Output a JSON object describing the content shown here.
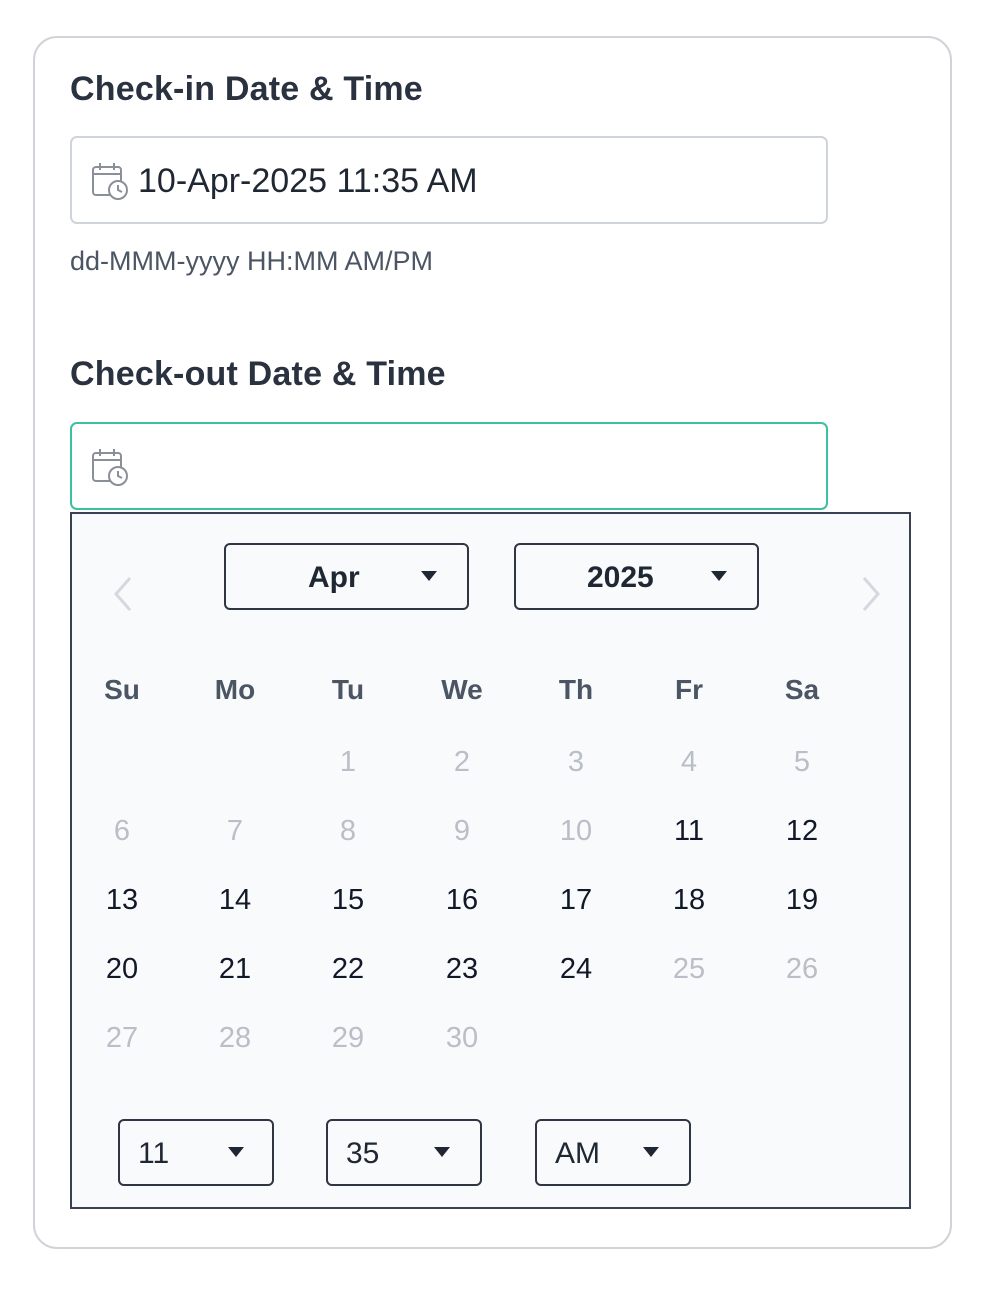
{
  "checkin": {
    "label": "Check-in Date & Time",
    "value": "10-Apr-2025 11:35 AM",
    "helper": "dd-MMM-yyyy HH:MM AM/PM",
    "icon": "calendar-clock-icon"
  },
  "checkout": {
    "label": "Check-out Date & Time",
    "value": "",
    "icon": "calendar-clock-icon"
  },
  "picker": {
    "month": "Apr",
    "year": "2025",
    "weekdays": [
      "Su",
      "Mo",
      "Tu",
      "We",
      "Th",
      "Fr",
      "Sa"
    ],
    "weeks": [
      [
        null,
        null,
        {
          "d": "1",
          "enabled": false
        },
        {
          "d": "2",
          "enabled": false
        },
        {
          "d": "3",
          "enabled": false
        },
        {
          "d": "4",
          "enabled": false
        },
        {
          "d": "5",
          "enabled": false
        }
      ],
      [
        {
          "d": "6",
          "enabled": false
        },
        {
          "d": "7",
          "enabled": false
        },
        {
          "d": "8",
          "enabled": false
        },
        {
          "d": "9",
          "enabled": false
        },
        {
          "d": "10",
          "enabled": false
        },
        {
          "d": "11",
          "enabled": true
        },
        {
          "d": "12",
          "enabled": true
        }
      ],
      [
        {
          "d": "13",
          "enabled": true
        },
        {
          "d": "14",
          "enabled": true
        },
        {
          "d": "15",
          "enabled": true
        },
        {
          "d": "16",
          "enabled": true
        },
        {
          "d": "17",
          "enabled": true
        },
        {
          "d": "18",
          "enabled": true
        },
        {
          "d": "19",
          "enabled": true
        }
      ],
      [
        {
          "d": "20",
          "enabled": true
        },
        {
          "d": "21",
          "enabled": true
        },
        {
          "d": "22",
          "enabled": true
        },
        {
          "d": "23",
          "enabled": true
        },
        {
          "d": "24",
          "enabled": true
        },
        {
          "d": "25",
          "enabled": false
        },
        {
          "d": "26",
          "enabled": false
        }
      ],
      [
        {
          "d": "27",
          "enabled": false
        },
        {
          "d": "28",
          "enabled": false
        },
        {
          "d": "29",
          "enabled": false
        },
        {
          "d": "30",
          "enabled": false
        },
        null,
        null,
        null
      ]
    ],
    "hour": "11",
    "minute": "35",
    "ampm": "AM",
    "prev_enabled": false,
    "next_enabled": false
  },
  "colors": {
    "focus_border": "#3dbfa2",
    "disabled_text": "#b9bec7",
    "enabled_text": "#111827"
  }
}
